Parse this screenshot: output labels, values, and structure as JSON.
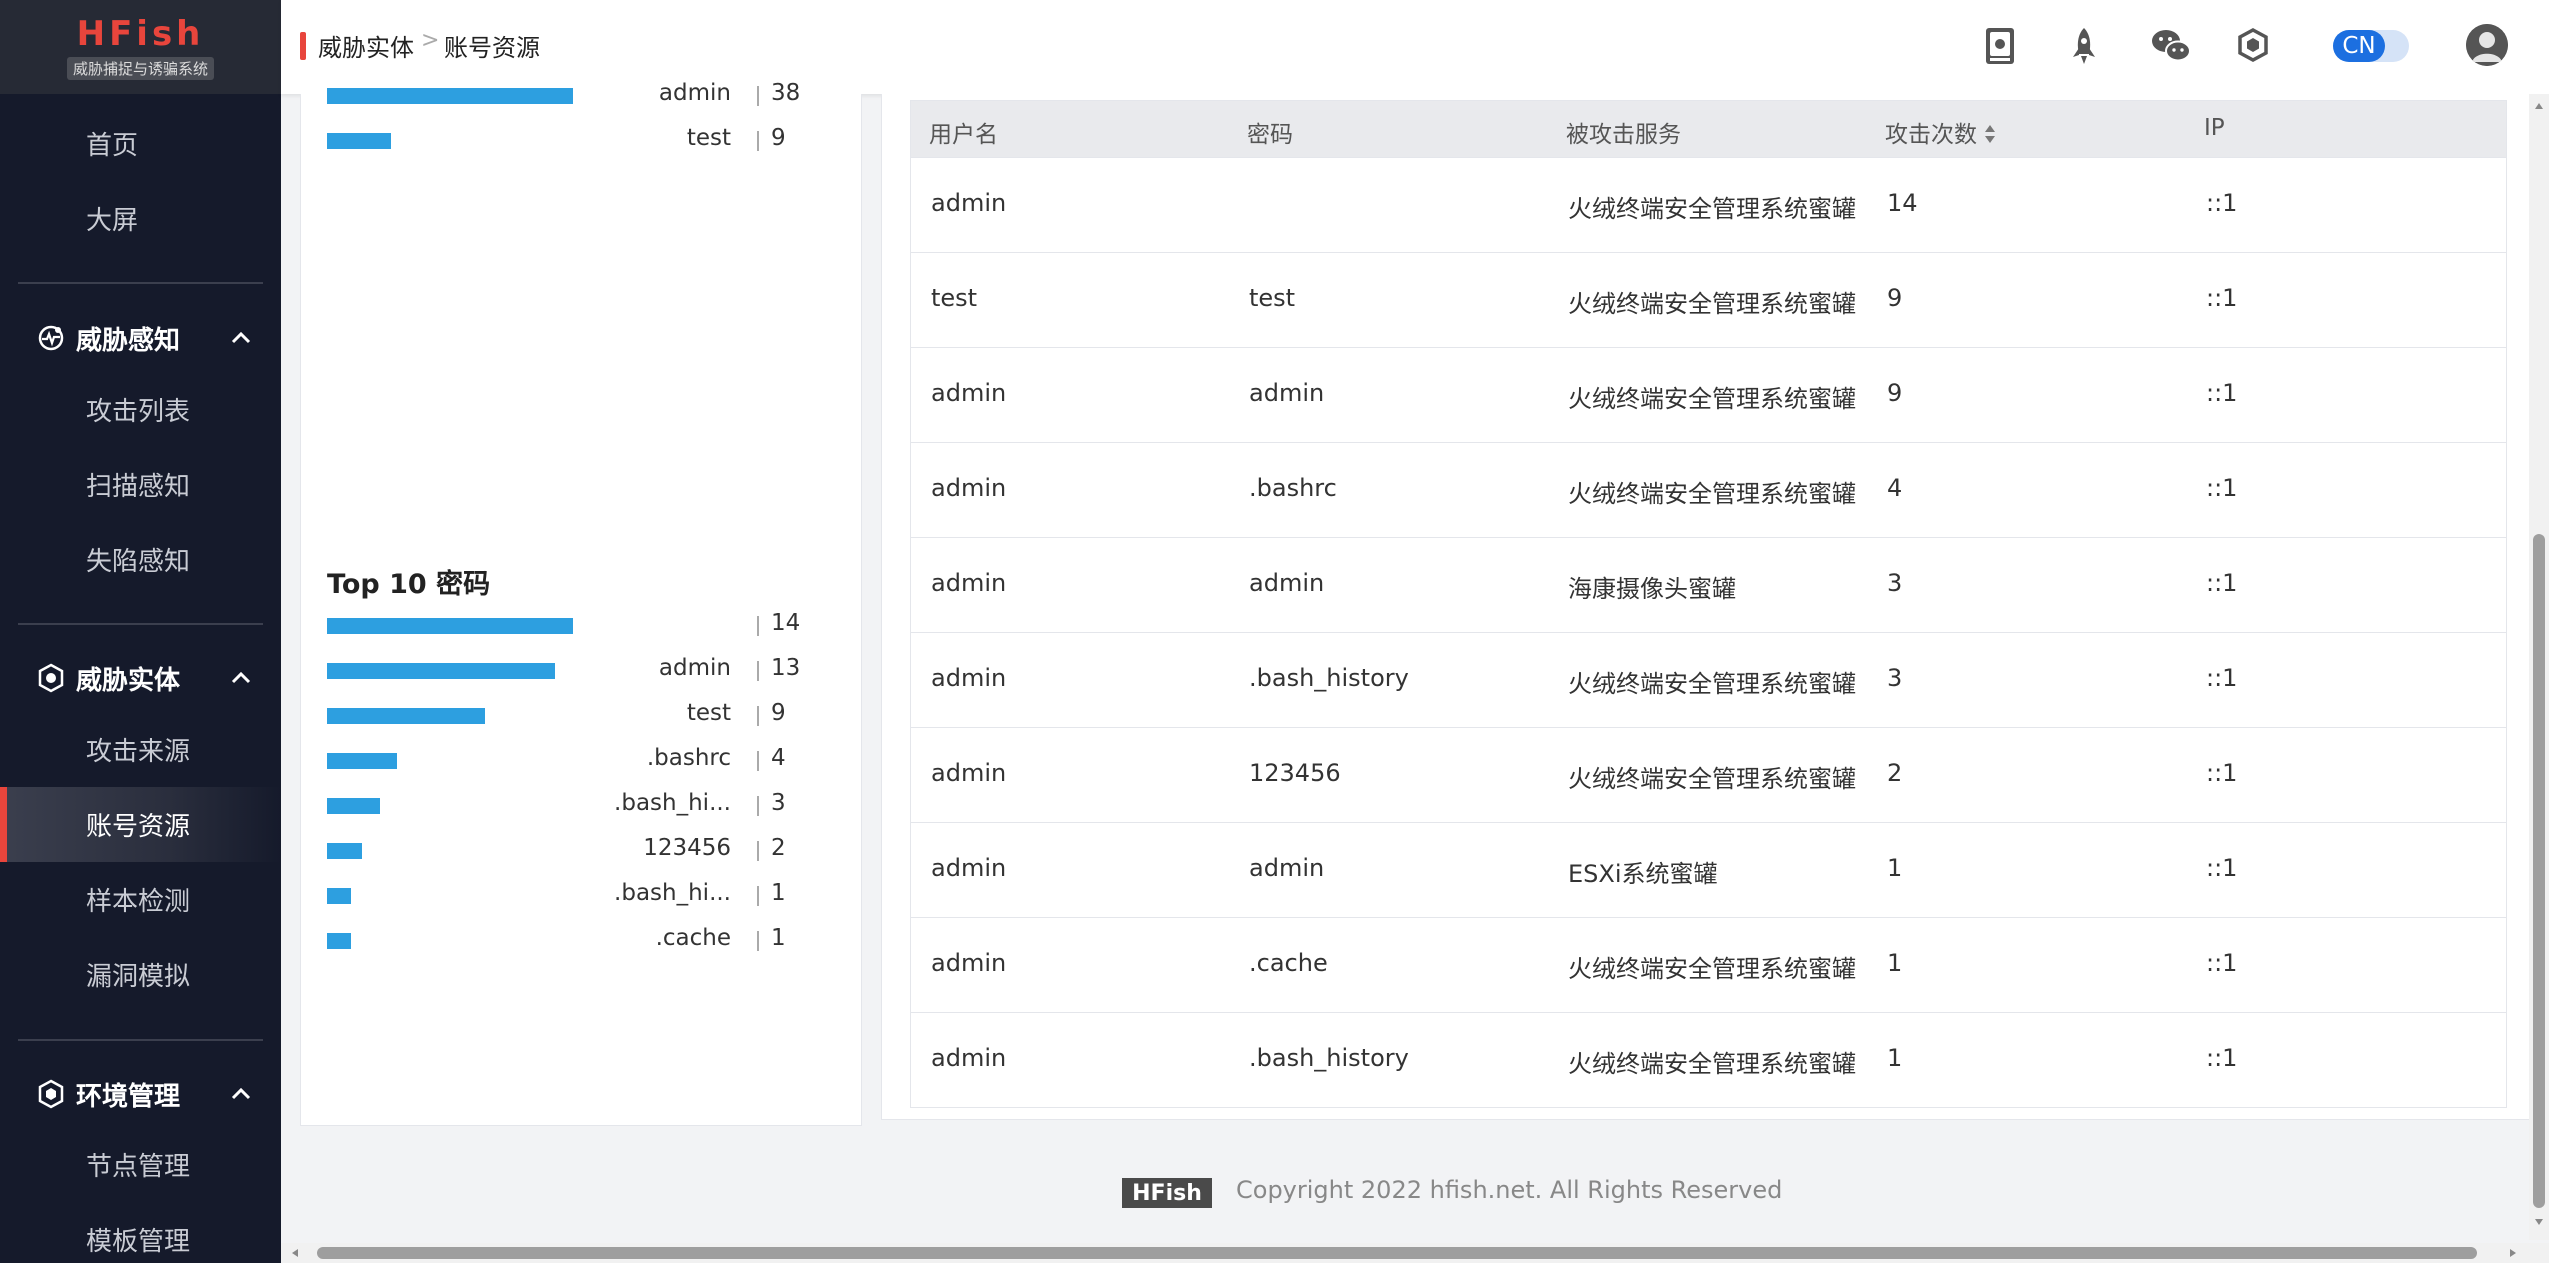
{
  "app": {
    "logo_title": "HFish",
    "logo_subtitle": "威胁捕捉与诱骗系统"
  },
  "sidebar": {
    "top_items": [
      {
        "label": "首页"
      },
      {
        "label": "大屏"
      }
    ],
    "groups": [
      {
        "label": "威胁感知",
        "icon": "radar-icon",
        "items": [
          {
            "label": "攻击列表"
          },
          {
            "label": "扫描感知"
          },
          {
            "label": "失陷感知"
          }
        ]
      },
      {
        "label": "威胁实体",
        "icon": "shield-icon",
        "items": [
          {
            "label": "攻击来源"
          },
          {
            "label": "账号资源",
            "active": true
          },
          {
            "label": "样本检测"
          },
          {
            "label": "漏洞模拟"
          }
        ]
      },
      {
        "label": "环境管理",
        "icon": "hexagon-icon",
        "items": [
          {
            "label": "节点管理"
          },
          {
            "label": "模板管理"
          }
        ]
      }
    ]
  },
  "header": {
    "breadcrumb": [
      "威胁实体",
      "账号资源"
    ],
    "breadcrumb_separator": ">",
    "icons": [
      "book-icon",
      "rocket-icon",
      "wechat-icon",
      "hexagon-icon"
    ],
    "lang": "CN",
    "accent_color": "#e8453c",
    "toggle_color": "#1c6fe0"
  },
  "top_users_partial": [
    {
      "label": "admin",
      "value": 38
    },
    {
      "label": "test",
      "value": 9
    }
  ],
  "top_passwords": {
    "title": "Top 10 密码",
    "bar_color": "#2d9fe0",
    "max_value": 14,
    "rows": [
      {
        "label": "",
        "value": 14
      },
      {
        "label": "admin",
        "value": 13
      },
      {
        "label": "test",
        "value": 9
      },
      {
        "label": ".bashrc",
        "value": 4
      },
      {
        "label": ".bash_hi...",
        "value": 3
      },
      {
        "label": "123456",
        "value": 2
      },
      {
        "label": ".bash_hi...",
        "value": 1
      },
      {
        "label": ".cache",
        "value": 1
      }
    ]
  },
  "table": {
    "columns": [
      "用户名",
      "密码",
      "被攻击服务",
      "攻击次数",
      "IP"
    ],
    "rows": [
      [
        "admin",
        "",
        "火绒终端安全管理系统蜜罐",
        "14",
        "::1"
      ],
      [
        "test",
        "test",
        "火绒终端安全管理系统蜜罐",
        "9",
        "::1"
      ],
      [
        "admin",
        "admin",
        "火绒终端安全管理系统蜜罐",
        "9",
        "::1"
      ],
      [
        "admin",
        ".bashrc",
        "火绒终端安全管理系统蜜罐",
        "4",
        "::1"
      ],
      [
        "admin",
        "admin",
        "海康摄像头蜜罐",
        "3",
        "::1"
      ],
      [
        "admin",
        ".bash_history",
        "火绒终端安全管理系统蜜罐",
        "3",
        "::1"
      ],
      [
        "admin",
        "123456",
        "火绒终端安全管理系统蜜罐",
        "2",
        "::1"
      ],
      [
        "admin",
        "admin",
        "ESXi系统蜜罐",
        "1",
        "::1"
      ],
      [
        "admin",
        ".cache",
        "火绒终端安全管理系统蜜罐",
        "1",
        "::1"
      ],
      [
        "admin",
        ".bash_history",
        "火绒终端安全管理系统蜜罐",
        "1",
        "::1"
      ]
    ]
  },
  "footer": {
    "badge": "HFish",
    "copyright": "Copyright 2022 hfish.net. All Rights Reserved"
  }
}
